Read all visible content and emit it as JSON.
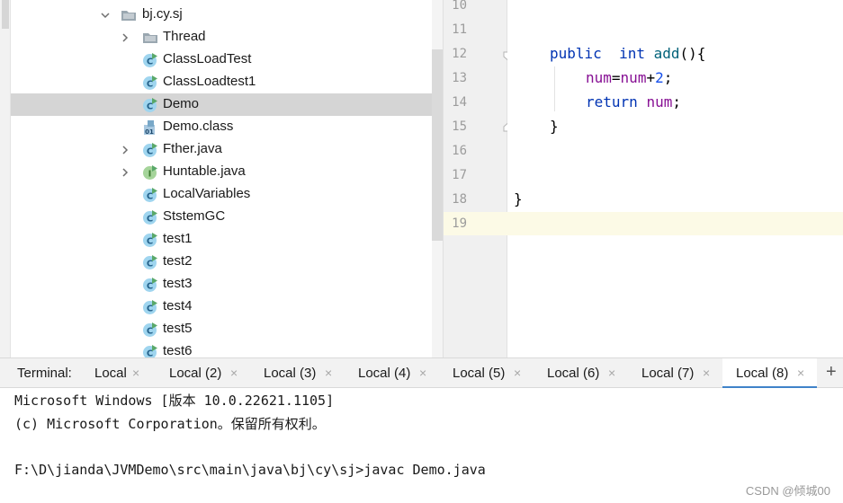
{
  "project_tree": {
    "package": {
      "label": "bj.cy.sj",
      "icon": "folder-icon",
      "expanded": true
    },
    "items": [
      {
        "label": "Thread",
        "icon": "folder-icon",
        "expandable": true,
        "selected": false
      },
      {
        "label": "ClassLoadTest",
        "icon": "java-class-icon",
        "expandable": false,
        "selected": false
      },
      {
        "label": "ClassLoadtest1",
        "icon": "java-class-icon",
        "expandable": false,
        "selected": false
      },
      {
        "label": "Demo",
        "icon": "java-class-icon",
        "expandable": false,
        "selected": true
      },
      {
        "label": "Demo.class",
        "icon": "class-file-icon",
        "expandable": false,
        "selected": false
      },
      {
        "label": "Fther.java",
        "icon": "java-class-icon",
        "expandable": true,
        "selected": false
      },
      {
        "label": "Huntable.java",
        "icon": "java-interface-icon",
        "expandable": true,
        "selected": false
      },
      {
        "label": "LocalVariables",
        "icon": "java-class-icon",
        "expandable": false,
        "selected": false
      },
      {
        "label": "StstemGC",
        "icon": "java-class-icon",
        "expandable": false,
        "selected": false
      },
      {
        "label": "test1",
        "icon": "java-class-icon",
        "expandable": false,
        "selected": false
      },
      {
        "label": "test2",
        "icon": "java-class-icon",
        "expandable": false,
        "selected": false
      },
      {
        "label": "test3",
        "icon": "java-class-icon",
        "expandable": false,
        "selected": false
      },
      {
        "label": "test4",
        "icon": "java-class-icon",
        "expandable": false,
        "selected": false
      },
      {
        "label": "test5",
        "icon": "java-class-icon",
        "expandable": false,
        "selected": false
      },
      {
        "label": "test6",
        "icon": "java-class-icon",
        "expandable": false,
        "selected": false
      }
    ]
  },
  "editor": {
    "line_numbers": [
      "10",
      "11",
      "12",
      "13",
      "14",
      "15",
      "16",
      "17",
      "18",
      "19"
    ],
    "code": {
      "line12_kw1": "public",
      "line12_kw2": "int",
      "line12_method": "add",
      "line12_rest": "(){",
      "line13_field1": "num",
      "line13_eq": "=",
      "line13_field2": "num",
      "line13_plus": "+",
      "line13_num": "2",
      "line13_semi": ";",
      "line14_kw": "return",
      "line14_field": "num",
      "line14_semi": ";",
      "line15_brace": "}",
      "line18_brace": "}"
    },
    "current_line": "19"
  },
  "terminal": {
    "title": "Terminal:",
    "tabs": [
      "Local",
      "Local (2)",
      "Local (3)",
      "Local (4)",
      "Local (5)",
      "Local (6)",
      "Local (7)",
      "Local (8)"
    ],
    "active_tab": "Local (8)",
    "close_glyph": "×",
    "add_glyph": "+",
    "output": [
      "Microsoft Windows [版本 10.0.22621.1105]",
      "(c) Microsoft Corporation。保留所有权利。",
      "",
      "F:\\D\\jianda\\JVMDemo\\src\\main\\java\\bj\\cy\\sj>javac Demo.java"
    ]
  },
  "watermark": "CSDN @倾城00",
  "colors": {
    "keyword": "#0033b3",
    "method": "#00627a",
    "field": "#871094",
    "number": "#1750eb",
    "selection": "#d5d5d5",
    "active_tab_underline": "#4083c9",
    "caret_line": "#fcfae6"
  }
}
